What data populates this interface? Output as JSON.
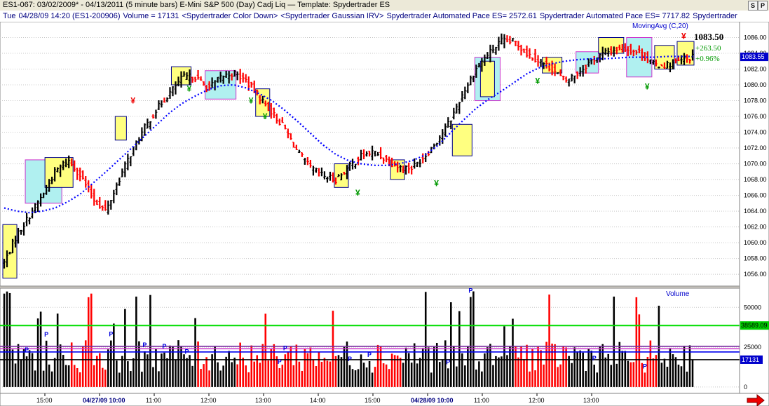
{
  "window": {
    "title": "ES1-067:  03/02/2009* - 04/13/2011  (5 minute bars)   E-Mini S&P 500 (Day) Cadj Liq  —  Template: Spydertrader ES",
    "btn_s": "S",
    "btn_p": "P"
  },
  "info": {
    "day": "Tue",
    "datetime": "04/28/09 14:20 (ES1-200906)",
    "volume": "Volume = 17131",
    "study1": "<Spydertrader Color Down>",
    "study2": "<Spydertrader Gaussian IRV>",
    "pace1": "Spydertrader Automated Pace ES= 2572.61",
    "pace2": "Spydertrader Automated Pace ES= 7717.82",
    "pace3": "Spydertrader"
  },
  "colors": {
    "up": "#000000",
    "down": "#ff0000",
    "ma": "#0000ff",
    "box": "#00008b",
    "fill_yellow": "#ffff80",
    "fill_cyan": "#b0f0f0",
    "green": "#00cc00",
    "magenta": "#cc33cc",
    "purple": "#7a2fa0"
  },
  "icons": [
    "yen-icon",
    "arrow-right-icon"
  ],
  "chart_data": [
    {
      "type": "candlestick",
      "name": "price-panel",
      "ylim": [
        1054.5,
        1088
      ],
      "yticks": [
        1056,
        1058,
        1060,
        1062,
        1064,
        1066,
        1068,
        1070,
        1072,
        1074,
        1076,
        1078,
        1080,
        1082,
        1084,
        1086
      ],
      "ytick_labels": [
        "1056.00",
        "1058.00",
        "1060.00",
        "1062.00",
        "1064.00",
        "1066.00",
        "1068.00",
        "1070.00",
        "1072.00",
        "1074.00",
        "1076.00",
        "1078.00",
        "1080.00",
        "1082.00",
        "1084.00",
        "1086.00"
      ],
      "last_price_label": "1083.55",
      "last_price": 1083.55,
      "indicator_label": "MovingAvg (C,20)",
      "summary": {
        "price": "1083.50",
        "change": "+263.50",
        "pct": "+0.96%"
      },
      "xticks": [
        "15:00",
        "04/27/09 10:00",
        "11:00",
        "12:00",
        "13:00",
        "14:00",
        "15:00",
        "04/28/09 10:00",
        "11:00",
        "12:00",
        "13:00"
      ],
      "anchors": [
        [
          1057.5,
          0
        ],
        [
          1061,
          0
        ],
        [
          1063.5,
          0
        ],
        [
          1066,
          0
        ],
        [
          1069,
          0
        ],
        [
          1070.5,
          0
        ],
        [
          1068.5,
          0
        ],
        [
          1065.5,
          -1
        ],
        [
          1064,
          0
        ],
        [
          1068,
          0
        ],
        [
          1071.5,
          0
        ],
        [
          1074.5,
          0
        ],
        [
          1077,
          0
        ],
        [
          1079,
          0
        ],
        [
          1081,
          0
        ],
        [
          1081,
          0
        ],
        [
          1079.5,
          0
        ],
        [
          1081,
          0
        ],
        [
          1081.5,
          0
        ],
        [
          1080.5,
          0
        ],
        [
          1078.5,
          0
        ],
        [
          1076.5,
          0
        ],
        [
          1074.5,
          0
        ],
        [
          1071.5,
          0
        ],
        [
          1069.5,
          0
        ],
        [
          1068.5,
          0
        ],
        [
          1068,
          0
        ],
        [
          1069.5,
          0
        ],
        [
          1071,
          0
        ],
        [
          1071.5,
          0
        ],
        [
          1070.5,
          0
        ],
        [
          1069.5,
          0
        ],
        [
          1069.5,
          0
        ],
        [
          1071,
          0
        ],
        [
          1073,
          0
        ],
        [
          1075.5,
          0
        ],
        [
          1079,
          0
        ],
        [
          1082,
          0
        ],
        [
          1084,
          0
        ],
        [
          1085.5,
          0
        ],
        [
          1085.5,
          0
        ],
        [
          1084,
          0
        ],
        [
          1083,
          0
        ],
        [
          1082,
          0
        ],
        [
          1080.5,
          0
        ],
        [
          1081.5,
          0
        ],
        [
          1083,
          0
        ],
        [
          1084,
          0
        ],
        [
          1084.5,
          0
        ],
        [
          1084.5,
          0
        ],
        [
          1084,
          0
        ],
        [
          1082.5,
          0
        ],
        [
          1082.5,
          0
        ],
        [
          1083,
          0
        ],
        [
          1083.5,
          0
        ]
      ],
      "ma": [
        [
          1064.4,
          0
        ],
        [
          1064,
          0
        ],
        [
          1063.8,
          0
        ],
        [
          1064,
          0
        ],
        [
          1064.4,
          0
        ],
        [
          1065.2,
          0
        ],
        [
          1066.2,
          0
        ],
        [
          1067.6,
          0
        ],
        [
          1069,
          0
        ],
        [
          1070.5,
          0
        ],
        [
          1072,
          0
        ],
        [
          1073.5,
          0
        ],
        [
          1075,
          0
        ],
        [
          1076.5,
          0
        ],
        [
          1077.7,
          0
        ],
        [
          1078.6,
          0
        ],
        [
          1079.4,
          0
        ],
        [
          1079.9,
          0
        ],
        [
          1080,
          0
        ],
        [
          1079.6,
          0
        ],
        [
          1078.9,
          0
        ],
        [
          1078,
          0
        ],
        [
          1076.8,
          0
        ],
        [
          1075.4,
          0
        ],
        [
          1073.9,
          0
        ],
        [
          1072.4,
          0
        ],
        [
          1071.2,
          0
        ],
        [
          1070.4,
          0
        ],
        [
          1070,
          0
        ],
        [
          1069.8,
          0
        ],
        [
          1069.8,
          0
        ],
        [
          1070,
          0
        ],
        [
          1070.4,
          0
        ],
        [
          1071.1,
          0
        ],
        [
          1072.3,
          0
        ],
        [
          1073.9,
          0
        ],
        [
          1075.5,
          0
        ],
        [
          1077,
          0
        ],
        [
          1078.2,
          0
        ],
        [
          1079.2,
          0
        ],
        [
          1080.3,
          0
        ],
        [
          1081.4,
          0
        ],
        [
          1082.2,
          0
        ],
        [
          1082.7,
          0
        ],
        [
          1083,
          0
        ],
        [
          1083.2,
          0
        ],
        [
          1083.3,
          0
        ],
        [
          1083.3,
          0
        ],
        [
          1083.4,
          0
        ],
        [
          1083.5,
          0
        ],
        [
          1083.5,
          0
        ],
        [
          1083.5,
          0
        ],
        [
          1083.6,
          0
        ],
        [
          1083.6,
          0
        ],
        [
          1083.6,
          0
        ]
      ],
      "bars": 246,
      "boxes": [
        {
          "from": 0,
          "to": 4,
          "lo": 1055.5,
          "hi": 1062.3,
          "fill": "yellow"
        },
        {
          "from": 8,
          "to": 20,
          "lo": 1065.0,
          "hi": 1070.5,
          "fill": "cyan"
        },
        {
          "from": 15,
          "to": 24,
          "lo": 1067.0,
          "hi": 1070.8,
          "fill": "yellow"
        },
        {
          "from": 40,
          "to": 43,
          "lo": 1073.0,
          "hi": 1076.0,
          "fill": "yellow"
        },
        {
          "from": 60,
          "to": 66,
          "lo": 1080.0,
          "hi": 1082.3,
          "fill": "yellow"
        },
        {
          "from": 72,
          "to": 82,
          "lo": 1078.2,
          "hi": 1081.8,
          "fill": "cyan"
        },
        {
          "from": 90,
          "to": 94,
          "lo": 1076.0,
          "hi": 1079.5,
          "fill": "yellow"
        },
        {
          "from": 118,
          "to": 122,
          "lo": 1067.0,
          "hi": 1070.0,
          "fill": "yellow"
        },
        {
          "from": 138,
          "to": 142,
          "lo": 1068.0,
          "hi": 1070.5,
          "fill": "yellow"
        },
        {
          "from": 160,
          "to": 166,
          "lo": 1071.0,
          "hi": 1075.0,
          "fill": "yellow"
        },
        {
          "from": 168,
          "to": 176,
          "lo": 1078.0,
          "hi": 1083.5,
          "fill": "cyan"
        },
        {
          "from": 170,
          "to": 174,
          "lo": 1078.5,
          "hi": 1083.0,
          "fill": "yellow"
        },
        {
          "from": 192,
          "to": 198,
          "lo": 1081.5,
          "hi": 1083.5,
          "fill": "yellow"
        },
        {
          "from": 204,
          "to": 211,
          "lo": 1081.5,
          "hi": 1084.2,
          "fill": "cyan"
        },
        {
          "from": 212,
          "to": 220,
          "lo": 1084.0,
          "hi": 1086.0,
          "fill": "yellow"
        },
        {
          "from": 222,
          "to": 230,
          "lo": 1081.0,
          "hi": 1086.0,
          "fill": "cyan"
        },
        {
          "from": 232,
          "to": 238,
          "lo": 1082.0,
          "hi": 1085.0,
          "fill": "yellow"
        },
        {
          "from": 240,
          "to": 245,
          "lo": 1082.5,
          "hi": 1085.5,
          "fill": "yellow"
        }
      ],
      "yen_marks": [
        {
          "bar": 46,
          "price": 1078.0,
          "color": "red"
        },
        {
          "bar": 66,
          "price": 1079.5,
          "color": "green"
        },
        {
          "bar": 88,
          "price": 1078.0,
          "color": "green"
        },
        {
          "bar": 93,
          "price": 1076.0,
          "color": "green"
        },
        {
          "bar": 126,
          "price": 1066.3,
          "color": "green"
        },
        {
          "bar": 154,
          "price": 1067.5,
          "color": "green"
        },
        {
          "bar": 190,
          "price": 1080.5,
          "color": "green"
        },
        {
          "bar": 229,
          "price": 1079.8,
          "color": "green"
        },
        {
          "bar": 242,
          "price": 1086.2,
          "color": "red"
        }
      ]
    },
    {
      "type": "bar",
      "name": "volume-panel",
      "title": "Volume",
      "ylim": [
        -4000,
        62000
      ],
      "yticks": [
        0,
        25000,
        50000
      ],
      "ytick_labels": [
        "0",
        "25000",
        "50000"
      ],
      "levels": [
        {
          "value": 38589,
          "label": "38589.09",
          "color": "green"
        },
        {
          "value": 25500,
          "label": "",
          "color": "purple"
        },
        {
          "value": 24000,
          "label": "",
          "color": "magenta"
        },
        {
          "value": 22000,
          "label": "",
          "color": "blue"
        },
        {
          "value": 17131,
          "label": "17131",
          "color": "black"
        }
      ],
      "last_volume": 17131,
      "p_marks": [
        8,
        15,
        38,
        50,
        57,
        65,
        98,
        100,
        123,
        130,
        158,
        166,
        210,
        228
      ]
    }
  ]
}
